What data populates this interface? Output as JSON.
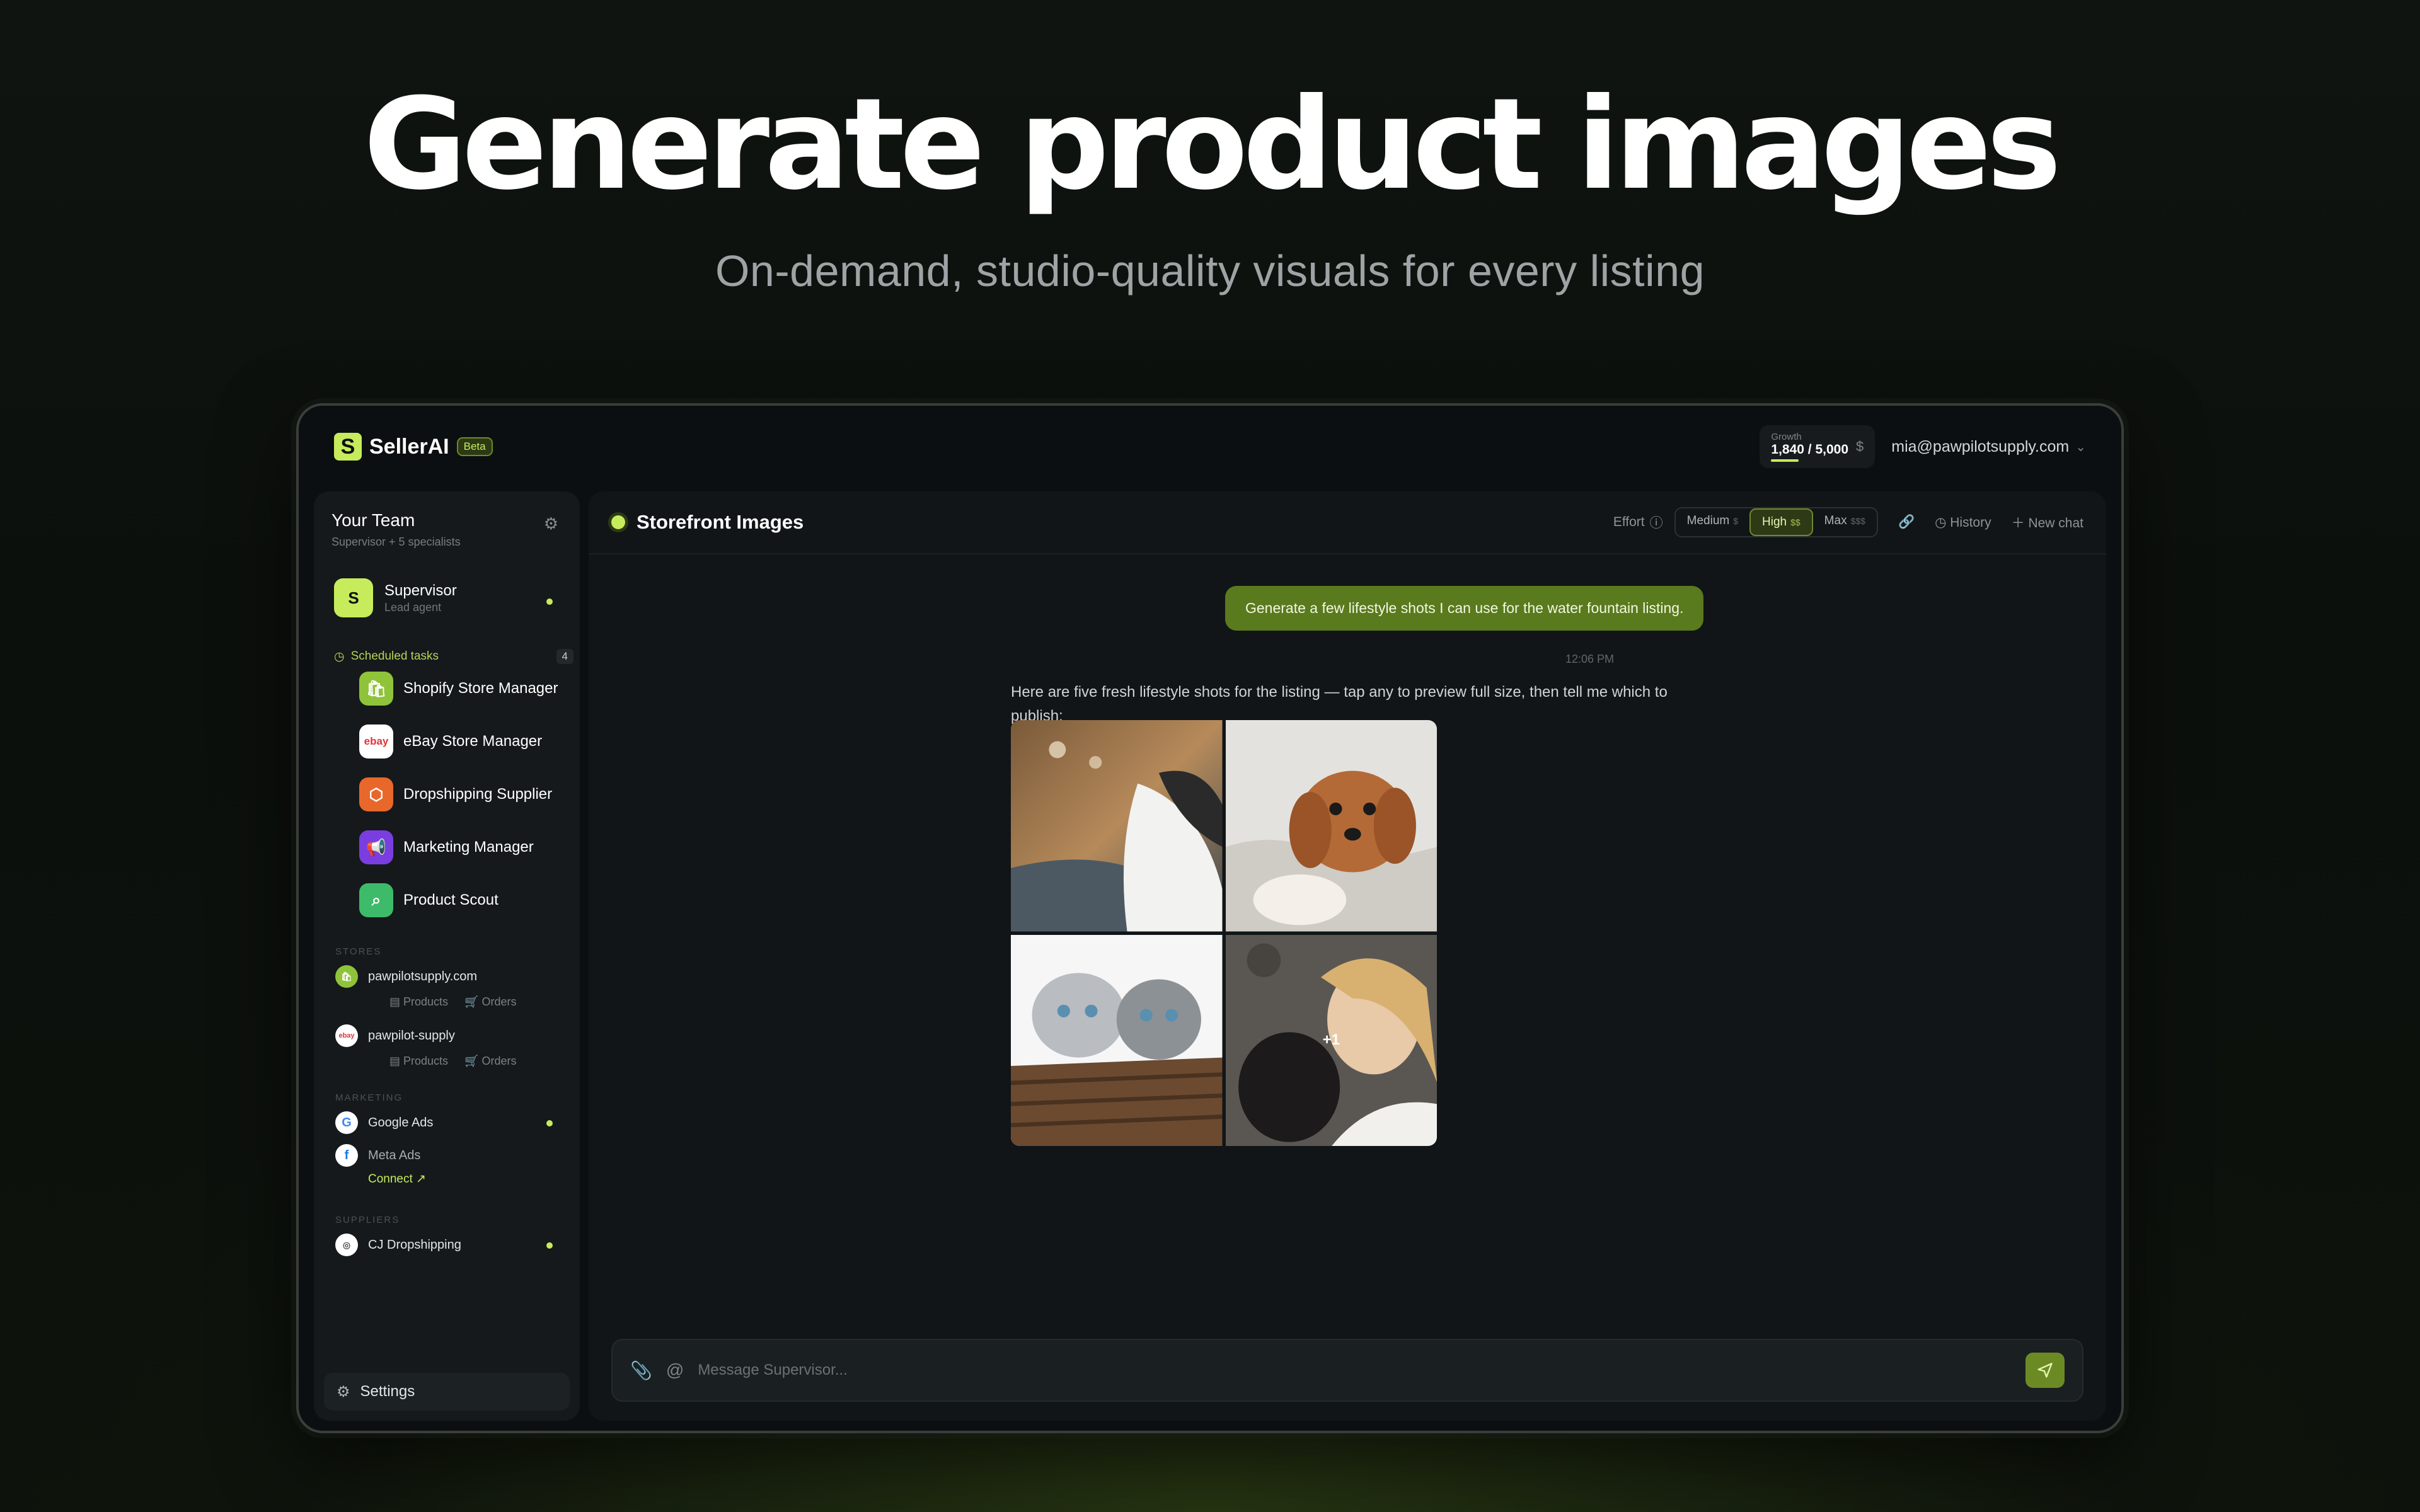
{
  "hero": {
    "title": "Generate product images",
    "subtitle": "On-demand, studio-quality visuals for every listing"
  },
  "app": {
    "brand": "SellerAI",
    "badge": "Beta",
    "credits": {
      "plan": "Growth",
      "usage": "1,840 / 5,000",
      "currency_icon": "$"
    },
    "account_email": "mia@pawpilotsupply.com"
  },
  "sidebar": {
    "team_title": "Your Team",
    "team_subtitle": "Supervisor + 5 specialists",
    "supervisor": {
      "name": "Supervisor",
      "role": "Lead agent"
    },
    "scheduled": {
      "label": "Scheduled tasks",
      "count": "4"
    },
    "agents": [
      {
        "name": "Shopify Store Manager",
        "icon": "shopify-icon",
        "color": "#8fc33a"
      },
      {
        "name": "eBay Store Manager",
        "icon": "ebay-icon",
        "color": "#ffffff"
      },
      {
        "name": "Dropshipping Supplier",
        "icon": "box-icon",
        "color": "#e8672a"
      },
      {
        "name": "Marketing Manager",
        "icon": "megaphone-icon",
        "color": "#7a3de0"
      },
      {
        "name": "Product Scout",
        "icon": "search-icon",
        "color": "#3dbb6a"
      }
    ],
    "stores_label": "STORES",
    "stores": [
      {
        "name": "pawpilotsupply.com",
        "links": [
          "Products",
          "Orders"
        ]
      },
      {
        "name": "pawpilot-supply",
        "links": [
          "Products",
          "Orders"
        ]
      }
    ],
    "marketing_label": "MARKETING",
    "marketing": [
      {
        "name": "Google Ads"
      },
      {
        "name": "Meta Ads",
        "action": "Connect"
      }
    ],
    "suppliers_label": "SUPPLIERS",
    "suppliers": [
      {
        "name": "CJ Dropshipping"
      }
    ],
    "settings_label": "Settings"
  },
  "chat": {
    "title": "Storefront Images",
    "effort_label": "Effort",
    "effort_options": [
      {
        "label": "Medium",
        "cost": "$"
      },
      {
        "label": "High",
        "cost": "$$"
      },
      {
        "label": "Max",
        "cost": "$$$"
      }
    ],
    "effort_selected": "High",
    "history_label": "History",
    "new_chat_label": "New chat",
    "user_message": "Generate a few lifestyle shots I can use for the water fountain listing.",
    "user_time": "12:06 PM",
    "assistant_message": "Here are five fresh lifestyle shots for the listing — tap any to preview full size, then tell me which to publish:",
    "gallery_more": "+1",
    "composer_placeholder": "Message Supervisor..."
  },
  "colors": {
    "accent": "#c6ec5c",
    "user_bubble": "#5a7a1e"
  }
}
